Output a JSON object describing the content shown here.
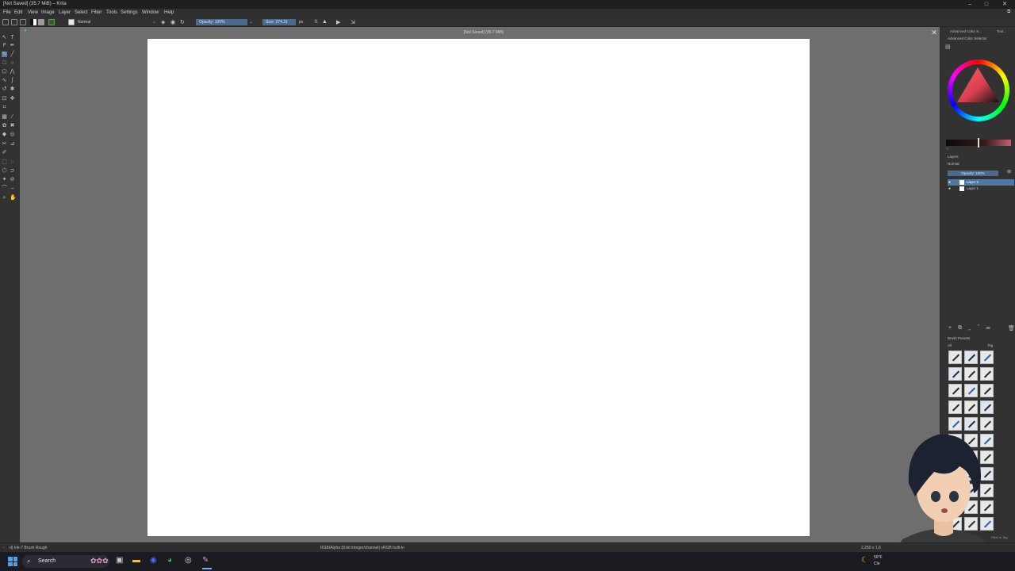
{
  "window": {
    "title": "[Not Saved]  (35.7 MiB)  – Krita"
  },
  "menu": [
    "File",
    "Edit",
    "View",
    "Image",
    "Layer",
    "Select",
    "Filter",
    "Tools",
    "Settings",
    "Window",
    "Help"
  ],
  "tool_options": {
    "blend_mode": "Normal",
    "opacity": "Opacity: 100%",
    "size": "Size: 274.31",
    "size_unit": "px"
  },
  "document": {
    "title": "[Not Saved]  (35.7 MiB)"
  },
  "right_panel": {
    "tabs": [
      "Advanced Color S...",
      "Tool..."
    ],
    "color_selector_title": "Advanced Color Selector",
    "layers_title": "Layers",
    "layers_blend": "Normal",
    "layers_opacity": "Opacity: 100%",
    "layers": [
      "Layer 2",
      "Layer 1"
    ],
    "brush_presets_title": "Brush Presets",
    "brush_filter": "All",
    "brush_tag": "Tag",
    "brush_footer": "Filter in Tag"
  },
  "status": {
    "brush": "d) Ink-7 Brush Rough",
    "color_space": "RGB/Alpha (8-bit integer/channel)  sRGB built-in",
    "zoom": "2,250 x 1,6"
  },
  "taskbar": {
    "search": "Search",
    "weather": "56°F",
    "weather2": "Cle"
  },
  "colors": {
    "accent": "#4a6a8e",
    "canvas": "#ffffff",
    "workspace": "#6e6e6e"
  }
}
